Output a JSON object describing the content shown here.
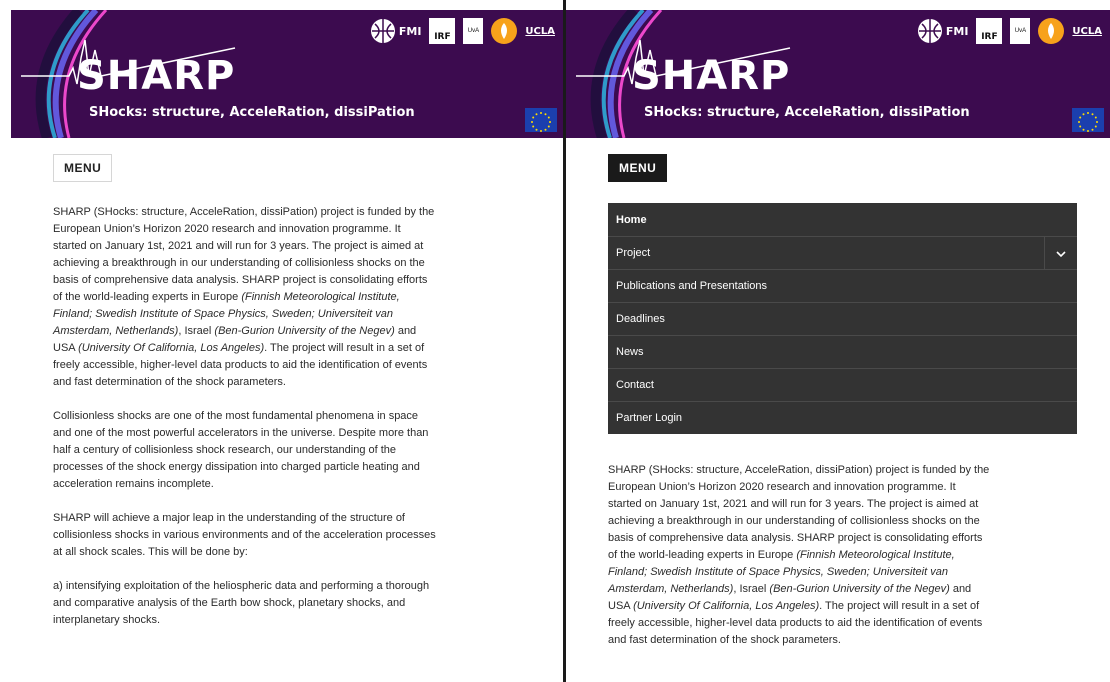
{
  "site": {
    "title": "SHARP",
    "subtitle": "SHocks: structure, AcceleRation, dissiPation",
    "logos": {
      "fmi": "FMI",
      "irf": "IRF",
      "uva": "UvA",
      "ucla": "UCLA"
    }
  },
  "menu_label": "MENU",
  "nav_items": [
    "Home",
    "Project",
    "Publications and Presentations",
    "Deadlines",
    "News",
    "Contact",
    "Partner Login"
  ],
  "intro": {
    "p1_a": "SHARP (SHocks: structure, AcceleRation, dissiPation) project is funded by the European Union’s Horizon 2020 research and innovation programme. It started on January 1st, 2021 and will run for 3 years. The project is aimed at achieving a breakthrough in our understanding of collisionless shocks on the basis of comprehensive data analysis. SHARP project is consolidating efforts of the world-leading experts in Europe ",
    "p1_b": "(Finnish Meteorological Institute, Finland; Swedish Institute of Space Physics, Sweden; Universiteit van Amsterdam, Netherlands)",
    "p1_c": ", Israel ",
    "p1_d": "(Ben-Gurion University of the Negev)",
    "p1_e": " and USA ",
    "p1_f": "(University Of California, Los Angeles)",
    "p1_g": ". The project will result in a set of freely accessible, higher-level data products to aid the identification of events and fast determination of the shock parameters.",
    "p2": "Collisionless shocks are one of the most fundamental phenomena in space and one of the most powerful accelerators in the universe. Despite more than half a century of collisionless shock research, our understanding of the processes of the shock energy dissipation into charged particle heating and acceleration remains incomplete.",
    "p3": "SHARP will achieve a major leap in the understanding of the structure of collisionless shocks in various environments and of the acceleration processes at all shock scales. This will be done by:",
    "p4": "a) intensifying exploitation of the heliospheric data and performing a thorough and comparative analysis of the Earth bow shock, planetary shocks, and interplanetary shocks."
  },
  "colors": {
    "banner": "#3c0b4f",
    "nav_bg": "#333333",
    "menu_active": "#1a1a1a",
    "eu_blue": "#1b3fae",
    "eu_star": "#ffdd00"
  }
}
